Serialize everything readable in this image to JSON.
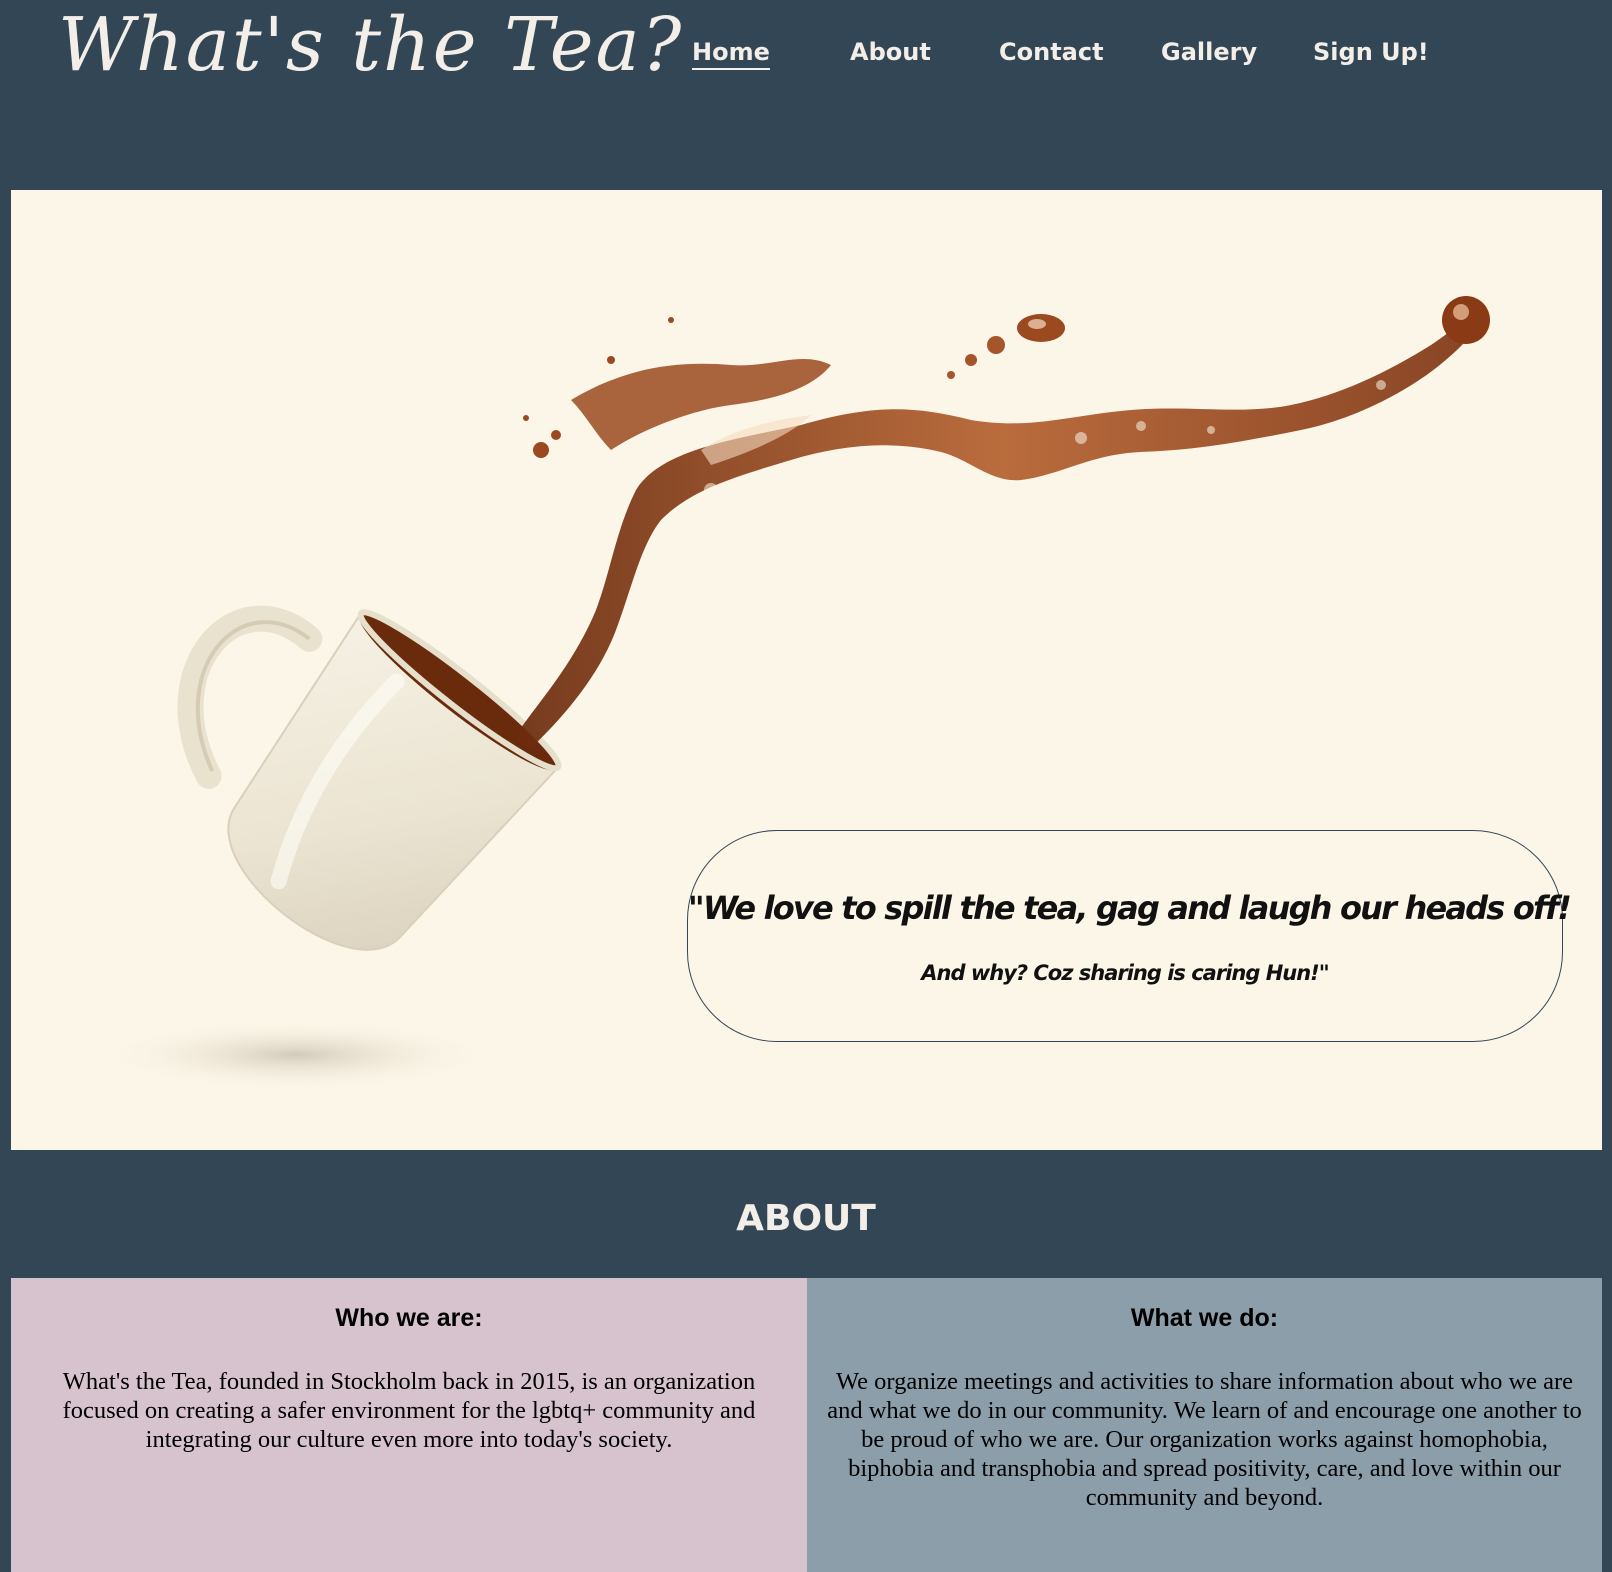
{
  "header": {
    "logo": "What's the Tea?",
    "nav": [
      {
        "label": "Home",
        "active": true
      },
      {
        "label": "About",
        "active": false
      },
      {
        "label": "Contact",
        "active": false
      },
      {
        "label": "Gallery",
        "active": false
      },
      {
        "label": "Sign Up!",
        "active": false
      }
    ]
  },
  "hero": {
    "image": "teacup-spill",
    "quote_main": "\"We love to spill the tea, gag and laugh our heads off!",
    "quote_sub": "And why? Coz sharing is caring Hun!\""
  },
  "about": {
    "title": "ABOUT",
    "left": {
      "heading": "Who we are:",
      "text": "What's the Tea, founded in Stockholm back in 2015, is an organization focused on creating a safer environment for the lgbtq+ community and integrating our culture even more into today's society."
    },
    "right": {
      "heading": "What we do:",
      "text": "We organize meetings and activities to share information about who we are and what we do in our community. We learn of and encourage one another to be proud of who we are. Our organization works against homophobia, biphobia and transphobia and spread positivity, care, and love within our community and beyond."
    }
  },
  "colors": {
    "header_bg": "#334656",
    "hero_bg": "#fcf6e8",
    "left_col_bg": "#d7c3cd",
    "right_col_bg": "#8d9eab",
    "tea": "#8a3a14"
  }
}
